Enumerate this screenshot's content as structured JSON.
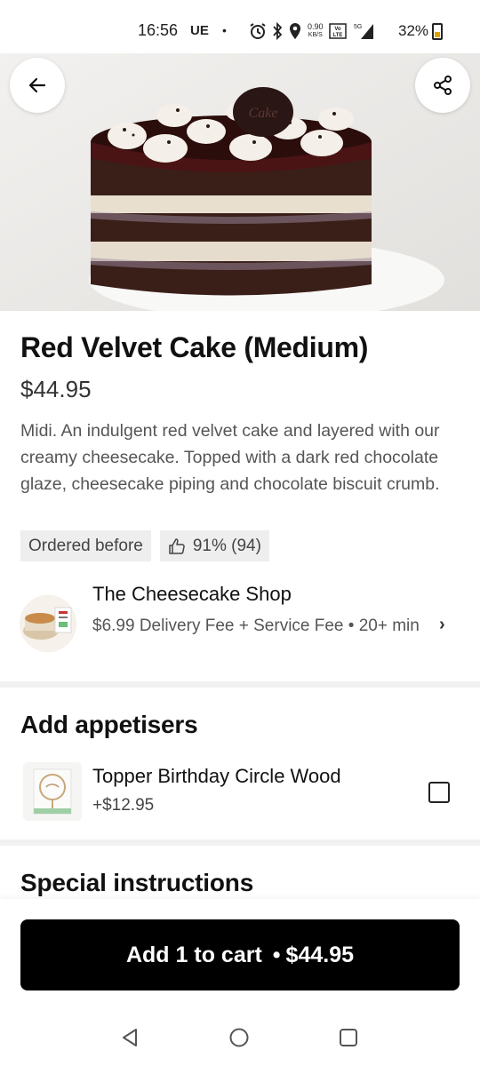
{
  "status_bar": {
    "time": "16:56",
    "carrier": "UE",
    "dot": "•",
    "speed_value": "0.90",
    "speed_unit": "KB/S",
    "volte": "VoLTE",
    "network": "5G",
    "battery": "32%"
  },
  "header": {
    "back_icon": "arrow-left-icon",
    "share_icon": "share-icon"
  },
  "product": {
    "title": "Red Velvet Cake (Medium)",
    "price": "$44.95",
    "description": "Midi. An indulgent red velvet cake and layered with our creamy cheesecake. Topped with a dark red chocolate glaze, cheesecake piping and chocolate biscuit crumb.",
    "badge_ordered": "Ordered before",
    "rating": "91% (94)"
  },
  "store": {
    "name": "The Cheesecake Shop",
    "fees": "$6.99 Delivery Fee + Service Fee • 20+ min",
    "chevron": "›"
  },
  "appetisers": {
    "heading": "Add appetisers",
    "items": [
      {
        "name": "Topper Birthday Circle Wood",
        "price": "+$12.95",
        "checked": false
      }
    ]
  },
  "special": {
    "heading": "Special instructions"
  },
  "cart": {
    "label": "Add 1 to cart",
    "separator": "•",
    "total": "$44.95"
  },
  "colors": {
    "cart_button": "#000000",
    "chip_bg": "#eeeeee"
  }
}
